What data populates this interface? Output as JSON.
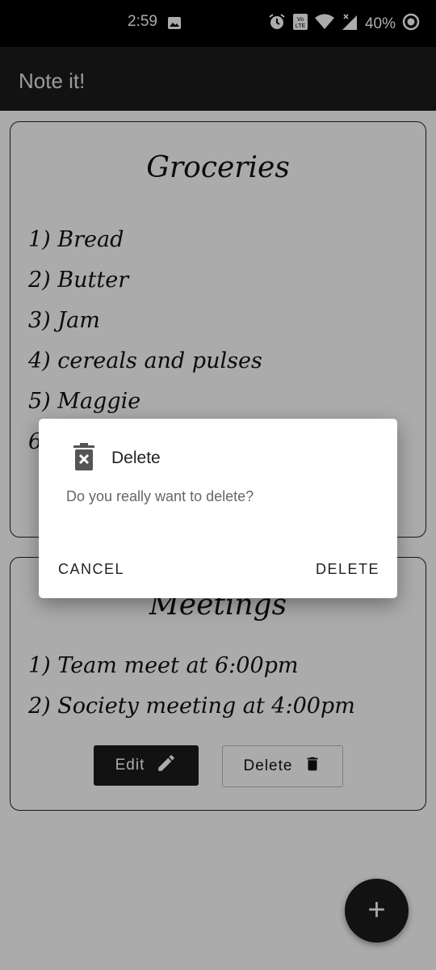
{
  "status_bar": {
    "time": "2:59",
    "battery": "40%"
  },
  "app_bar": {
    "title": "Note it!"
  },
  "notes": [
    {
      "title": "Groceries",
      "items": [
        "1) Bread",
        "2) Butter",
        "3) Jam",
        "4) cereals and pulses",
        "5) Maggie",
        "6)"
      ]
    },
    {
      "title": "Meetings",
      "items": [
        "1) Team meet at 6:00pm",
        "2) Society meeting at 4:00pm"
      ],
      "edit_label": "Edit",
      "delete_label": "Delete"
    }
  ],
  "fab": {
    "label": "+"
  },
  "dialog": {
    "title": "Delete",
    "message": "Do you really want to delete?",
    "cancel_label": "CANCEL",
    "confirm_label": "DELETE"
  },
  "colors": {
    "app_bar": "#1b1b1b",
    "button_dark": "#1b1b1b",
    "scrim": "rgba(0,0,0,0.33)"
  }
}
